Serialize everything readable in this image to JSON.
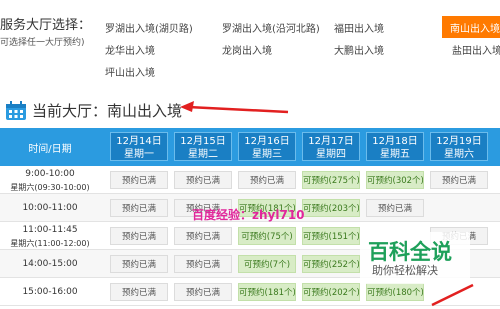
{
  "select": {
    "label": "服务大厅选择：",
    "sub": "可选择任一大厅预约)",
    "halls": [
      {
        "label": "罗湖出入境(湖贝路)"
      },
      {
        "label": "罗湖出入境(沿河北路)"
      },
      {
        "label": "福田出入境"
      },
      {
        "label": "南山出入境"
      },
      {
        "label": "龙华出入境"
      },
      {
        "label": "龙岗出入境"
      },
      {
        "label": "大鹏出入境"
      },
      {
        "label": "盐田出入境"
      },
      {
        "label": "坪山出入境"
      }
    ]
  },
  "current": {
    "title": "当前大厅：南山出入境"
  },
  "table": {
    "time_header": "时间/日期",
    "days": [
      {
        "date": "12月14日",
        "weekday": "星期一"
      },
      {
        "date": "12月15日",
        "weekday": "星期二"
      },
      {
        "date": "12月16日",
        "weekday": "星期三"
      },
      {
        "date": "12月17日",
        "weekday": "星期四"
      },
      {
        "date": "12月18日",
        "weekday": "星期五"
      },
      {
        "date": "12月19日",
        "weekday": "星期六"
      }
    ],
    "rows": [
      {
        "time": "9:00-10:00",
        "time2": "星期六(09:30-10:00)",
        "slots": [
          "预约已满",
          "预约已满",
          "预约已满",
          "可预约(275个)",
          "可预约(302个)",
          "预约已满"
        ]
      },
      {
        "time": "10:00-11:00",
        "time2": "",
        "slots": [
          "预约已满",
          "预约已满",
          "可预约(181个)",
          "可预约(203个)",
          "预约已满",
          ""
        ]
      },
      {
        "time": "11:00-11:45",
        "time2": "星期六(11:00-12:00)",
        "slots": [
          "预约已满",
          "预约已满",
          "可预约(75个)",
          "可预约(151个)",
          "",
          "预约已满"
        ]
      },
      {
        "time": "14:00-15:00",
        "time2": "",
        "slots": [
          "预约已满",
          "预约已满",
          "可预约(7个)",
          "可预约(252个)",
          "",
          ""
        ]
      },
      {
        "time": "15:00-16:00",
        "time2": "",
        "slots": [
          "预约已满",
          "预约已满",
          "可预约(181个)",
          "可预约(202个)",
          "可预约(180个)",
          ""
        ]
      }
    ]
  },
  "watermark": {
    "text": "百度经验：zhyl710",
    "brand": "百科全说",
    "tagline": "助你轻松解决"
  },
  "colors": {
    "accent": "#2b9be0",
    "active": "#ff7a00",
    "available": "#d8ecc6"
  }
}
